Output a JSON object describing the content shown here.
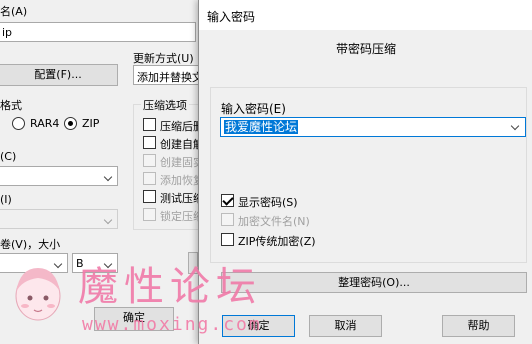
{
  "background_dialog": {
    "archive_name_label": "名(A)",
    "archive_name_value": "ip",
    "profiles_button": "配置(F)...",
    "update_mode_label": "更新方式(U)",
    "update_mode_value": "添加并替换文",
    "archive_format_label": "格式",
    "format_rar4": "RAR4",
    "format_zip": "ZIP",
    "compression_method_label": "(C)",
    "dictionary_label": "(I)",
    "split_label": "卷(V)，大小",
    "split_unit": "B",
    "options_group_label": "压缩选项",
    "options": [
      {
        "label": "压缩后删",
        "disabled": false
      },
      {
        "label": "创建自解",
        "disabled": false
      },
      {
        "label": "创建固实",
        "disabled": true
      },
      {
        "label": "添加恢复",
        "disabled": true
      },
      {
        "label": "测试压缩",
        "disabled": false
      },
      {
        "label": "锁定压缩",
        "disabled": true
      }
    ],
    "ok_button": "确定"
  },
  "password_dialog": {
    "title": "输入密码",
    "heading": "带密码压缩",
    "password_label": "输入密码(E)",
    "password_value": "我爱魔性论坛",
    "options": {
      "show_password": {
        "label": "显示密码(S)",
        "checked": true,
        "disabled": false
      },
      "encrypt_filenames": {
        "label": "加密文件名(N)",
        "checked": false,
        "disabled": true
      },
      "zip_legacy": {
        "label": "ZIP传统加密(Z)",
        "checked": false,
        "disabled": false
      }
    },
    "organize_button": "整理密码(O)...",
    "ok_button": "确定",
    "cancel_button": "取消",
    "help_button": "帮助"
  },
  "watermark": {
    "text": "魔性论坛",
    "url": "www.moxing.com"
  }
}
